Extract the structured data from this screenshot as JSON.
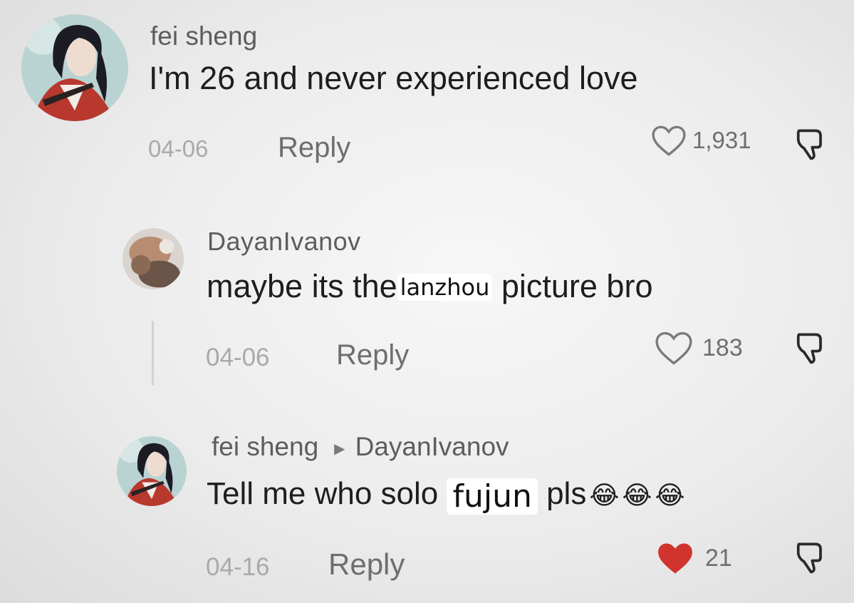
{
  "comments": [
    {
      "username": "fei sheng",
      "text": "I'm 26 and never experienced love",
      "date": "04-06",
      "reply_label": "Reply",
      "likes": "1,931",
      "liked": false,
      "avatar": "anime-character-avatar"
    },
    {
      "username": "DayanIvanov",
      "text_before": "maybe its the",
      "text_pasted": "lanzhou",
      "text_after": " picture bro",
      "date": "04-06",
      "reply_label": "Reply",
      "likes": "183",
      "liked": false,
      "avatar": "blurred-photo-avatar"
    },
    {
      "username": "fei sheng",
      "reply_to": "DayanIvanov",
      "text_before": "Tell me who solo ",
      "text_pasted": "fujun",
      "text_after": " pls",
      "emojis": [
        "😂",
        "😂",
        "😂"
      ],
      "date": "04-16",
      "reply_label": "Reply",
      "likes": "21",
      "liked": true,
      "avatar": "anime-character-avatar"
    }
  ],
  "colors": {
    "liked_heart": "#d0342c",
    "heart_outline": "#7a7a7a"
  }
}
